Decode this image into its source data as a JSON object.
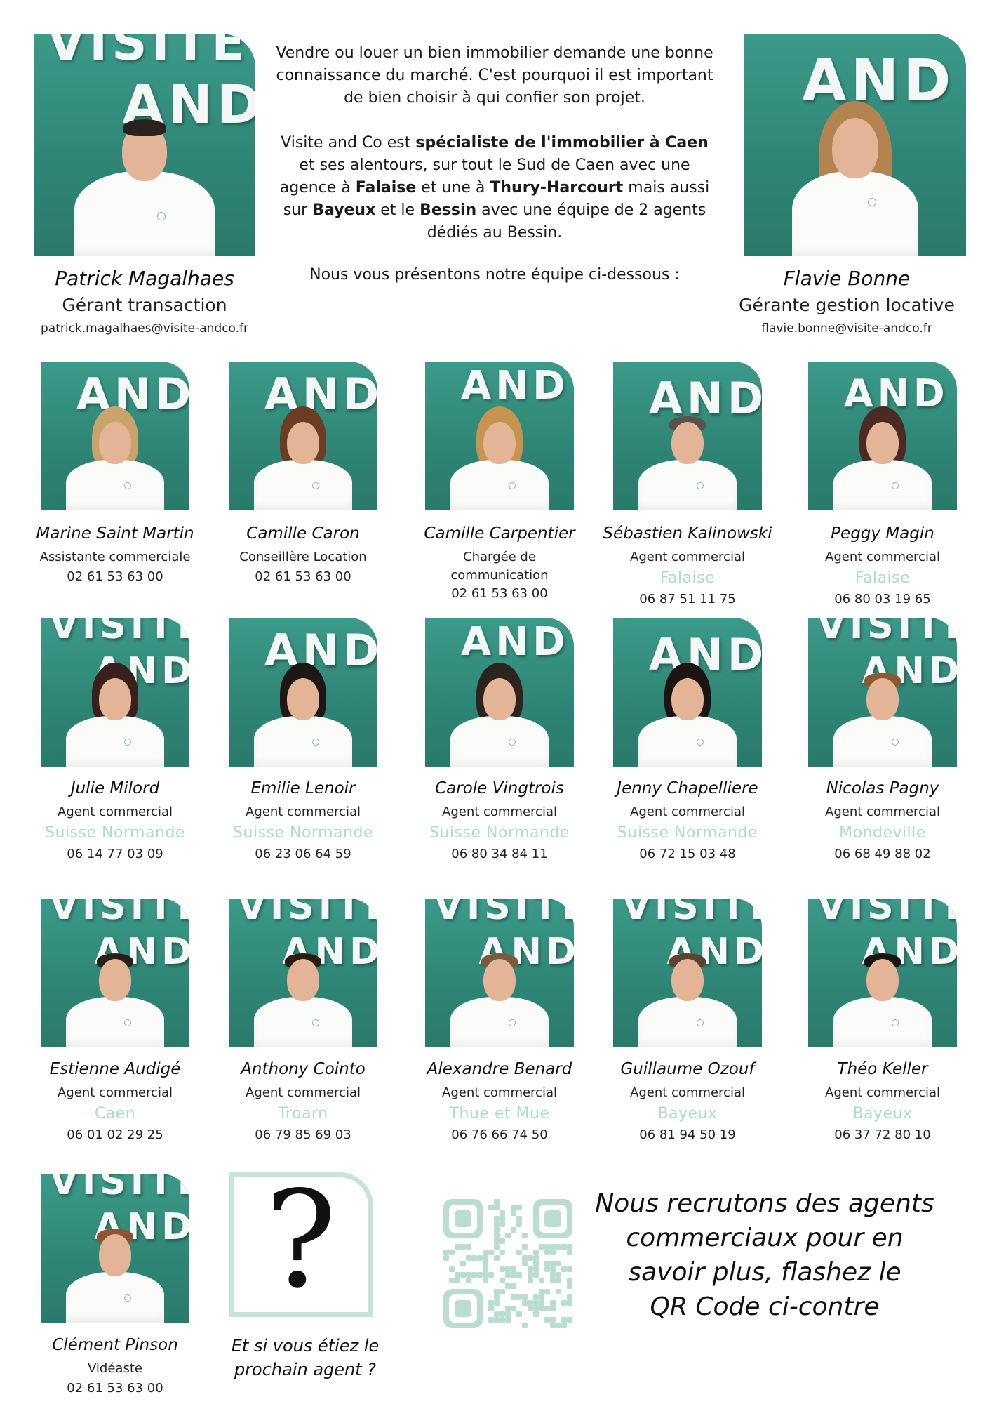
{
  "intro": {
    "p1": "Vendre ou louer un bien immobilier demande une bonne connaissance du marché. C'est pourquoi il est important de bien choisir à qui confier son projet.",
    "p2_parts": [
      "Visite and Co est ",
      "spécialiste de l'immobilier à Caen",
      " et ses alentours, sur tout le Sud de Caen avec une agence à ",
      "Falaise",
      " et une à ",
      "Thury-Harcourt",
      " mais aussi sur ",
      "Bayeux",
      " et le ",
      "Bessin",
      " avec une équipe de 2 agents dédiés au Bessin."
    ],
    "p3": "Nous vous présentons notre équipe ci-dessous :"
  },
  "managers": [
    {
      "name": "Patrick Magalhaes",
      "role": "Gérant transaction",
      "email": "patrick.magalhaes@visite-andco.fr"
    },
    {
      "name": "Flavie Bonne",
      "role": "Gérante gestion locative",
      "email": "flavie.bonne@visite-andco.fr"
    }
  ],
  "wall_text": {
    "top": "VISITE",
    "bottom": "AND CO"
  },
  "team": [
    {
      "name": "Marine Saint Martin",
      "role": "Assistante commerciale",
      "phone": "02 61 53 63 00"
    },
    {
      "name": "Camille Caron",
      "role": "Conseillère Location",
      "phone": "02 61 53 63 00"
    },
    {
      "name": "Camille Carpentier",
      "role_l1": "Chargée de",
      "role_l2": "communication",
      "phone": "02 61 53 63 00"
    },
    {
      "name": "Sébastien Kalinowski",
      "role": "Agent commercial",
      "city": "Falaise",
      "phone": "06 87 51 11 75"
    },
    {
      "name": "Peggy Magin",
      "role": "Agent commercial",
      "city": "Falaise",
      "phone": "06 80 03 19 65"
    },
    {
      "name": "Julie Milord",
      "role": "Agent commercial",
      "city": "Suisse Normande",
      "phone": "06 14 77 03 09"
    },
    {
      "name": "Emilie Lenoir",
      "role": "Agent commercial",
      "city": "Suisse Normande",
      "phone": "06 23 06 64 59"
    },
    {
      "name": "Carole Vingtrois",
      "role": "Agent commercial",
      "city": "Suisse Normande",
      "phone": "06 80 34 84 11"
    },
    {
      "name": "Jenny Chapelliere",
      "role": "Agent commercial",
      "city": "Suisse Normande",
      "phone": "06 72 15 03 48"
    },
    {
      "name": "Nicolas Pagny",
      "role": "Agent commercial",
      "city": "Mondeville",
      "phone": "06 68 49 88 02"
    },
    {
      "name": "Estienne Audigé",
      "role": "Agent commercial",
      "city": "Caen",
      "phone": "06 01 02 29 25"
    },
    {
      "name": "Anthony Cointo",
      "role": "Agent commercial",
      "city": "Troarn",
      "phone": "06 79 85 69 03"
    },
    {
      "name": "Alexandre Benard",
      "role": "Agent commercial",
      "city": "Thue et Mue",
      "phone": "06 76 66 74 50"
    },
    {
      "name": "Guillaume Ozouf",
      "role": "Agent commercial",
      "city": "Bayeux",
      "phone": "06 81 94 50 19"
    },
    {
      "name": "Théo Keller",
      "role": "Agent commercial",
      "city": "Bayeux",
      "phone": "06 37 72 80 10"
    },
    {
      "name": "Clément Pinson",
      "role": "Vidéaste",
      "phone": "02 61 53 63 00"
    }
  ],
  "next_agent": {
    "line1": "Et si vous étiez le",
    "line2": "prochain agent ?",
    "symbol": "?"
  },
  "recruit": {
    "lines": [
      "Nous recrutons des agents",
      "commerciaux pour en",
      "savoir plus, flashez le",
      "QR Code ci-contre"
    ]
  },
  "colors": {
    "accent_teal": "#2f8676",
    "city_mint": "#a9dccd",
    "qr_mint": "#b9ddd0"
  }
}
